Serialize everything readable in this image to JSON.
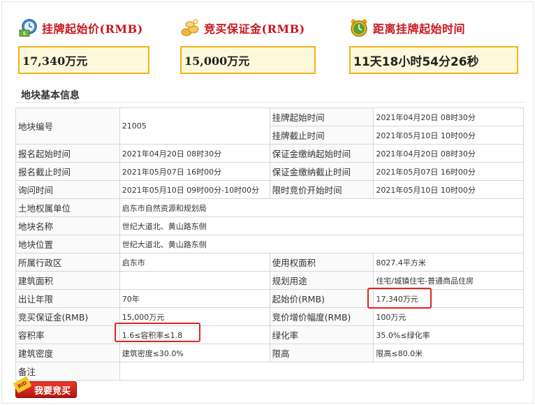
{
  "summary": {
    "start_price": {
      "label": "挂牌起始价(RMB)",
      "value": "17,340万元",
      "icon": "money-clock-icon"
    },
    "deposit": {
      "label": "竞买保证金(RMB)",
      "value": "15,000万元",
      "icon": "coins-icon"
    },
    "countdown": {
      "label": "距离挂牌起始时间",
      "value": "11天18小时54分26秒",
      "icon": "alarm-clock-icon"
    }
  },
  "section_title": "地块基本信息",
  "table": {
    "parcel_no_label": "地块编号",
    "parcel_no": "21005",
    "listing_start_label": "挂牌起始时间",
    "listing_start": "2021年04月20日 08时30分",
    "listing_end_label": "挂牌截止时间",
    "listing_end": "2021年05月10日 10时00分",
    "reg_start_label": "报名起始时间",
    "reg_start": "2021年04月20日 08时30分",
    "deposit_start_label": "保证金缴纳起始时间",
    "deposit_start": "2021年04月20日 08时30分",
    "reg_end_label": "报名截止时间",
    "reg_end": "2021年05月07日 16时00分",
    "deposit_end_label": "保证金缴纳截止时间",
    "deposit_end": "2021年05月07日 16时00分",
    "inquiry_label": "询问时间",
    "inquiry": "2021年05月10日 09时00分-10时00分",
    "timed_bid_label": "限时竞价开始时间",
    "timed_bid": "2021年05月10日 10时00分",
    "owner_label": "土地权属单位",
    "owner": "启东市自然资源和规划局",
    "name_label": "地块名称",
    "name": "世纪大道北、黄山路东侧",
    "location_label": "地块位置",
    "location": "世纪大道北、黄山路东侧",
    "district_label": "所属行政区",
    "district": "启东市",
    "use_area_label": "使用权面积",
    "use_area": "8027.4平方米",
    "build_area_label": "建筑面积",
    "build_area": "",
    "planning_use_label": "规划用途",
    "planning_use": "住宅/城镇住宅-普通商品住房",
    "term_label": "出让年限",
    "term": "70年",
    "start_price_label": "起始价(RMB)",
    "start_price": "17,340万元",
    "bid_deposit_label": "竞买保证金(RMB)",
    "bid_deposit": "15,000万元",
    "increment_label": "竞价增价幅度(RMB)",
    "increment": "100万元",
    "far_label": "容积率",
    "far": "1.6≤容积率≤1.8",
    "green_label": "绿化率",
    "green": "35.0%≤绿化率",
    "density_label": "建筑密度",
    "density": "建筑密度≤30.0%",
    "height_label": "限高",
    "height": "限高≤80.0米",
    "remarks_label": "备注",
    "remarks": ""
  },
  "bid_button": {
    "label": "我要竞买",
    "tag": "BID"
  }
}
